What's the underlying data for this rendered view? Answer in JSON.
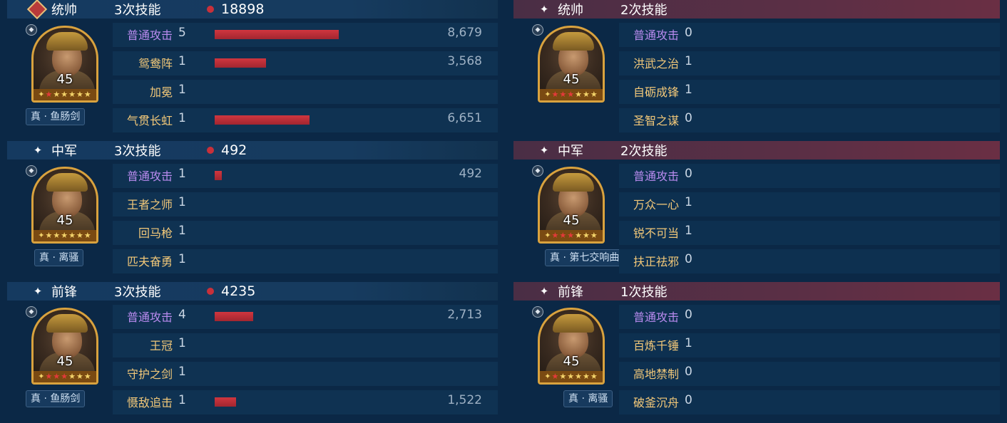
{
  "left": {
    "sections": [
      {
        "position": "统帅",
        "icon": "commander-badge-icon",
        "skills_count": "3次技能",
        "damage": "18898",
        "level": "45",
        "equipment": "真 · 鱼肠剑",
        "skills": [
          {
            "name": "普通攻击",
            "count": "5",
            "value": "8,679",
            "ratio": 1.0
          },
          {
            "name": "鸳鸯阵",
            "count": "1",
            "value": "3,568",
            "ratio": 0.411
          },
          {
            "name": "加冕",
            "count": "1",
            "value": "",
            "ratio": 0
          },
          {
            "name": "气贯长虹",
            "count": "1",
            "value": "6,651",
            "ratio": 0.766
          }
        ]
      },
      {
        "position": "中军",
        "icon": "star-icon",
        "skills_count": "3次技能",
        "damage": "492",
        "level": "45",
        "equipment": "真 · 离骚",
        "skills": [
          {
            "name": "普通攻击",
            "count": "1",
            "value": "492",
            "ratio": 0.057
          },
          {
            "name": "王者之师",
            "count": "1",
            "value": "",
            "ratio": 0
          },
          {
            "name": "回马枪",
            "count": "1",
            "value": "",
            "ratio": 0
          },
          {
            "name": "匹夫奋勇",
            "count": "1",
            "value": "",
            "ratio": 0
          }
        ]
      },
      {
        "position": "前锋",
        "icon": "star-icon",
        "skills_count": "3次技能",
        "damage": "4235",
        "level": "45",
        "equipment": "真 · 鱼肠剑",
        "skills": [
          {
            "name": "普通攻击",
            "count": "4",
            "value": "2,713",
            "ratio": 0.313
          },
          {
            "name": "王冠",
            "count": "1",
            "value": "",
            "ratio": 0
          },
          {
            "name": "守护之剑",
            "count": "1",
            "value": "",
            "ratio": 0
          },
          {
            "name": "慑敌追击",
            "count": "1",
            "value": "1,522",
            "ratio": 0.175
          }
        ]
      }
    ]
  },
  "right": {
    "sections": [
      {
        "position": "统帅",
        "icon": "star-icon",
        "skills_count": "2次技能",
        "level": "45",
        "skills": [
          {
            "name": "普通攻击",
            "count": "0"
          },
          {
            "name": "洪武之治",
            "count": "1"
          },
          {
            "name": "自砺成锋",
            "count": "1"
          },
          {
            "name": "圣智之谋",
            "count": "0"
          }
        ]
      },
      {
        "position": "中军",
        "icon": "star-icon",
        "skills_count": "2次技能",
        "level": "45",
        "equipment": "真 · 第七交响曲",
        "skills": [
          {
            "name": "普通攻击",
            "count": "0"
          },
          {
            "name": "万众一心",
            "count": "1"
          },
          {
            "name": "锐不可当",
            "count": "1"
          },
          {
            "name": "扶正祛邪",
            "count": "0"
          }
        ]
      },
      {
        "position": "前锋",
        "icon": "star-icon",
        "skills_count": "1次技能",
        "level": "45",
        "equipment": "真 · 离骚",
        "skills": [
          {
            "name": "普通攻击",
            "count": "0"
          },
          {
            "name": "百炼千锤",
            "count": "1"
          },
          {
            "name": "高地禁制",
            "count": "0"
          },
          {
            "name": "破釜沉舟",
            "count": "0"
          }
        ]
      }
    ]
  },
  "stars": {
    "star_glyph": "★",
    "small_star_glyph": "✦",
    "star_icon": "✦"
  },
  "colors": {
    "bar": "#c8303a",
    "attack_skill": "#b98bef",
    "skill": "#f2c879",
    "frame": "#d9a23e"
  }
}
